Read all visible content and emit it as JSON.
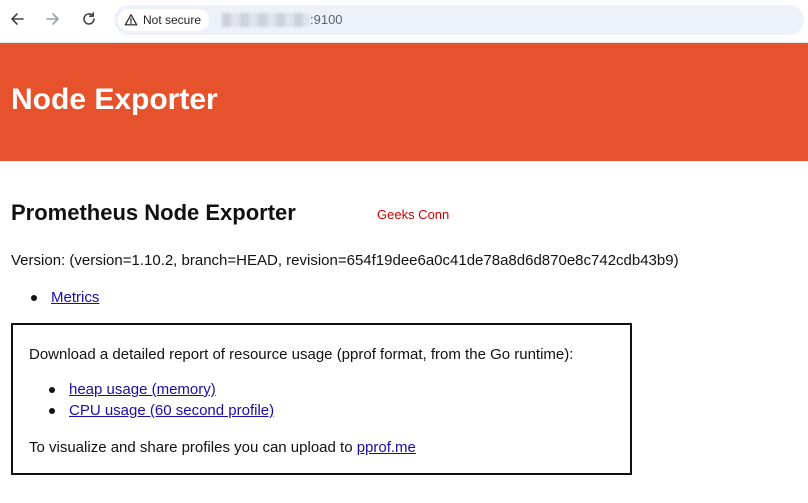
{
  "browser": {
    "security_label": "Not secure",
    "url_suffix": ":9100",
    "icons": [
      "back-arrow-icon",
      "forward-arrow-icon",
      "reload-icon",
      "warning-icon"
    ]
  },
  "header": {
    "title": "Node Exporter",
    "color": "#e6522c"
  },
  "main": {
    "title": "Prometheus Node Exporter",
    "watermark": "Geeks Conn",
    "version": "Version: (version=1.10.2, branch=HEAD, revision=654f19dee6a0c41de78a8d6d870e8c742cdb43b9)",
    "links": [
      {
        "label": "Metrics"
      }
    ]
  },
  "pprof": {
    "intro": "Download a detailed report of resource usage (pprof format, from the Go runtime):",
    "links": [
      {
        "label": "heap usage (memory)"
      },
      {
        "label": "CPU usage (60 second profile)"
      }
    ],
    "footer_text": "To visualize and share profiles you can upload to ",
    "footer_link": "pprof.me"
  },
  "colors": {
    "link": "#1a0dab",
    "watermark": "#d10000"
  }
}
